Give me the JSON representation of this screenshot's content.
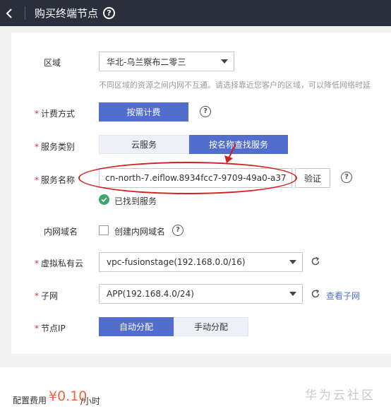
{
  "header": {
    "title": "购买终端节点",
    "help_glyph": "?"
  },
  "form": {
    "region": {
      "label": "区域",
      "value": "华北-乌兰察布二零三",
      "hint": "不同区域的资源之间内网不互通。请选择靠近您客户的区域，可以降低网络时延"
    },
    "billing": {
      "label": "计费方式",
      "option": "按需计费",
      "help_glyph": "?"
    },
    "service_type": {
      "label": "服务类别",
      "options": [
        "云服务",
        "按名称查找服务"
      ]
    },
    "service_name": {
      "label": "服务名称",
      "value": "cn-north-7.eiflow.8934fcc7-9709-49a0-a37",
      "verify_label": "验证",
      "help_glyph": "?",
      "found_text": "已找到服务"
    },
    "internal_domain": {
      "label": "内网域名",
      "checkbox_label": "创建内网域名",
      "help_glyph": "?"
    },
    "vpc": {
      "label": "虚拟私有云",
      "value": "vpc-fusionstage(192.168.0.0/16)"
    },
    "subnet": {
      "label": "子网",
      "value": "APP(192.168.4.0/24)",
      "link": "查看子网"
    },
    "node_ip": {
      "label": "节点IP",
      "options": [
        "自动分配",
        "手动分配"
      ]
    },
    "required_mark": "*"
  },
  "footer": {
    "fee_label": "配置费用",
    "price": "¥0.10",
    "unit": "/小时",
    "watermark": "华为云社区"
  },
  "colors": {
    "header_bg": "#2a2f3c",
    "primary": "#526ecc",
    "required": "#e62e2e",
    "price": "#f0653b",
    "success": "#3aa86b",
    "annotation": "#d21f1f"
  }
}
